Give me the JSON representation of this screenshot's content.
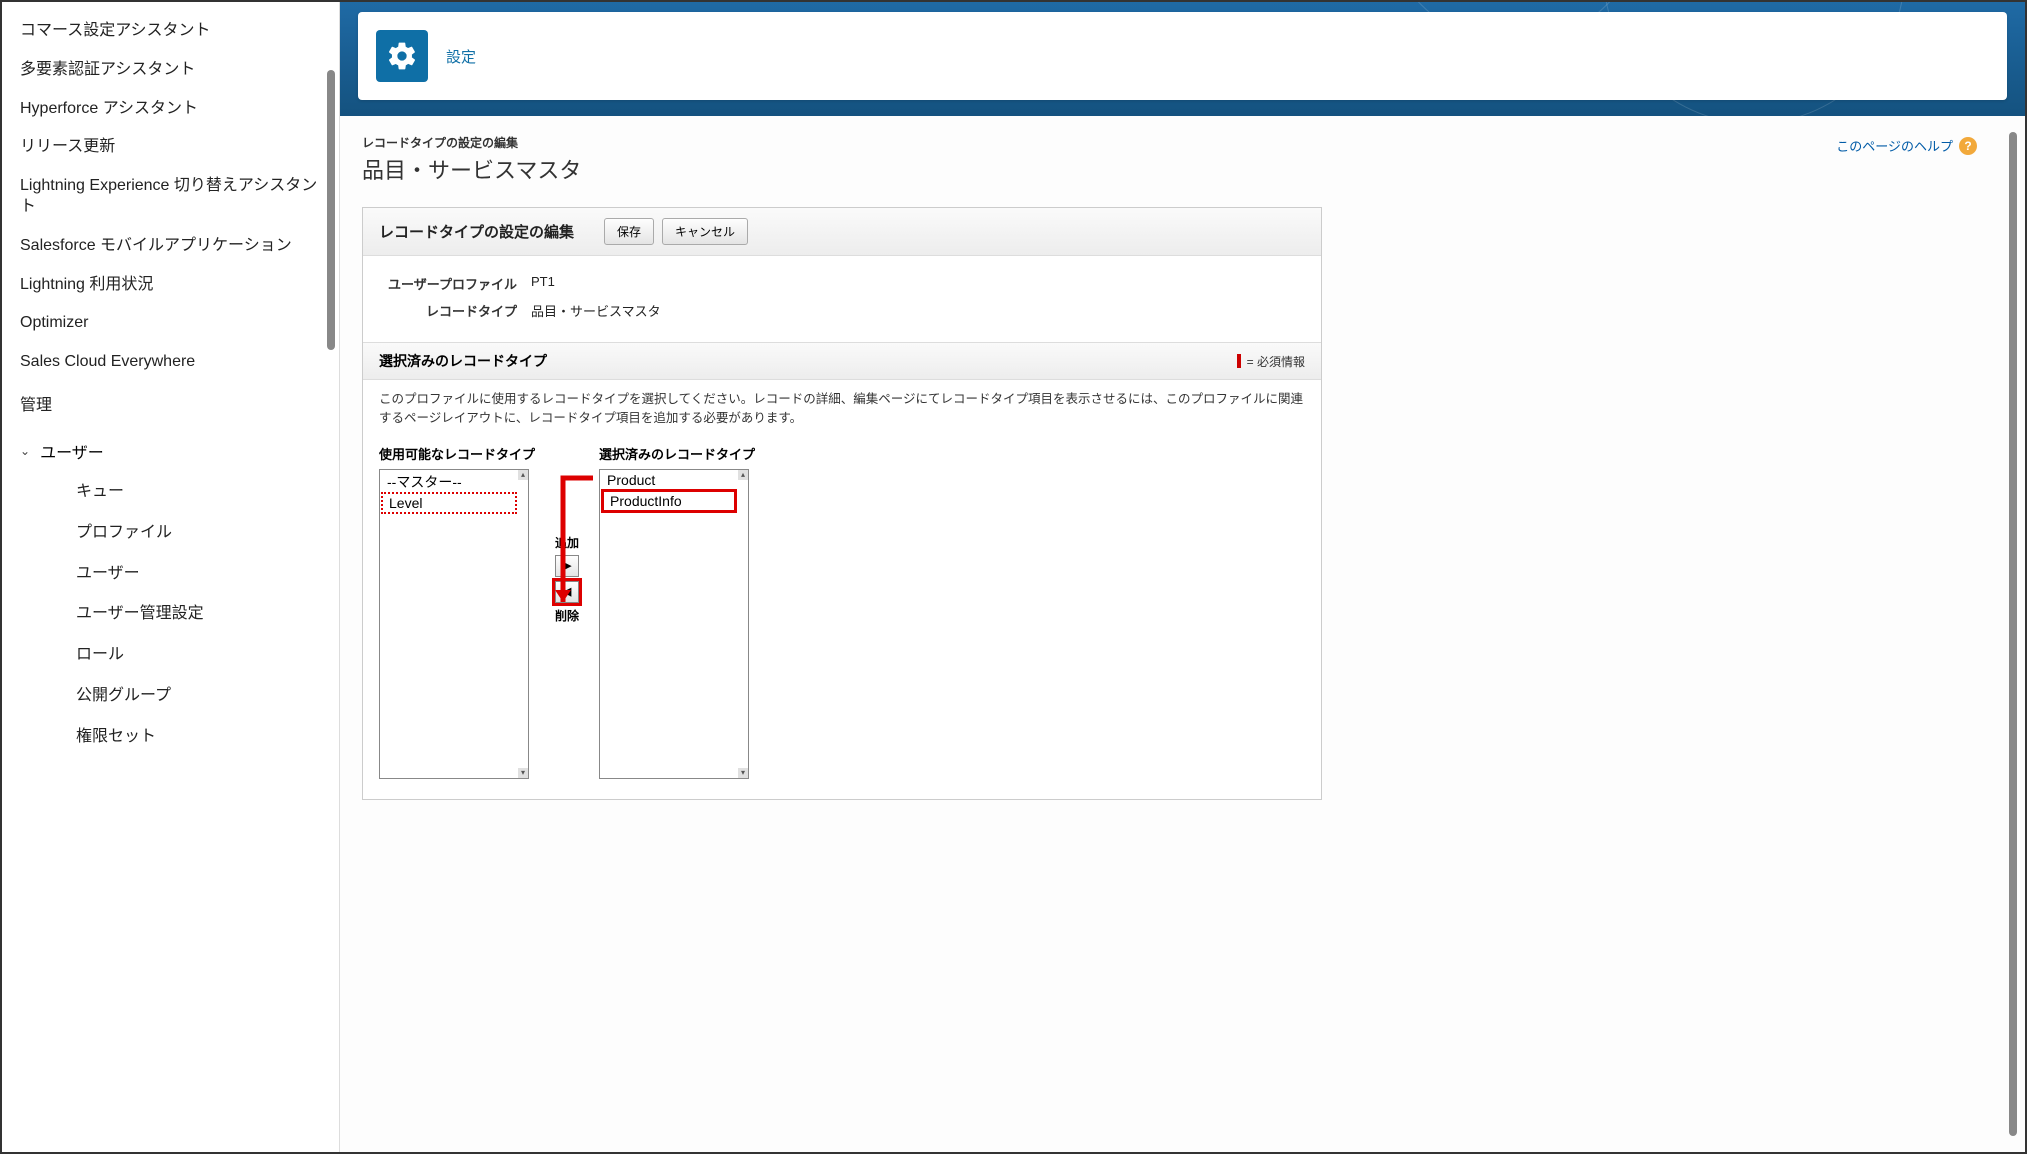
{
  "sidebar": {
    "items": [
      "コマース設定アシスタント",
      "多要素認証アシスタント",
      "Hyperforce アシスタント",
      "リリース更新",
      "Lightning Experience 切り替えアシスタント",
      "Salesforce モバイルアプリケーション",
      "Lightning 利用状況",
      "Optimizer",
      "Sales Cloud Everywhere"
    ],
    "section_label": "管理",
    "group_label": "ユーザー",
    "sub_items": [
      "キュー",
      "プロファイル",
      "ユーザー",
      "ユーザー管理設定",
      "ロール",
      "公開グループ",
      "権限セット"
    ]
  },
  "header": {
    "title": "設定"
  },
  "page": {
    "overline": "レコードタイプの設定の編集",
    "title": "品目・サービスマスタ",
    "help_label": "このページのヘルプ"
  },
  "panel": {
    "header_title": "レコードタイプの設定の編集",
    "save_label": "保存",
    "cancel_label": "キャンセル",
    "rows": {
      "profile_label": "ユーザープロファイル",
      "profile_value": "PT1",
      "recordtype_label": "レコードタイプ",
      "recordtype_value": "品目・サービスマスタ"
    },
    "sub_title": "選択済みのレコードタイプ",
    "required_note": "= 必須情報",
    "helptext": "このプロファイルに使用するレコードタイプを選択してください。レコードの詳細、編集ページにてレコードタイプ項目を表示させるには、このプロファイルに関連するページレイアウトに、レコードタイプ項目を追加する必要があります。",
    "available_label": "使用可能なレコードタイプ",
    "selected_label": "選択済みのレコードタイプ",
    "available_options": [
      "--マスター--",
      "Level"
    ],
    "selected_options": [
      "Product",
      "ProductInfo"
    ],
    "add_label": "追加",
    "remove_label": "削除"
  }
}
